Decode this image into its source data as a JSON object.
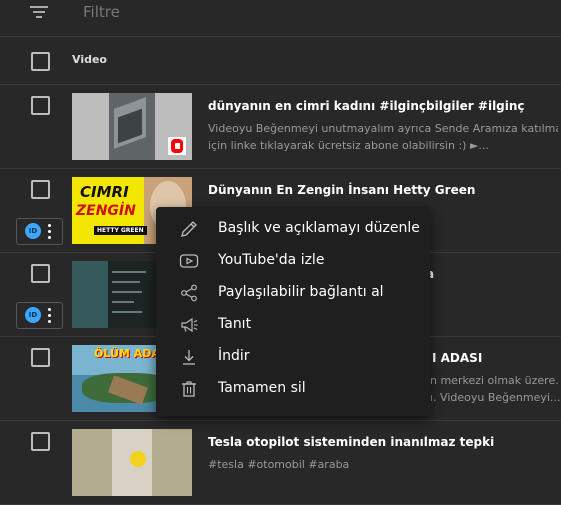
{
  "filter": {
    "placeholder": "Filtre"
  },
  "table": {
    "column_video": "Video"
  },
  "rows": [
    {
      "title": "dünyanın en cimri kadını #ilginçbilgiler #ilginç",
      "desc_line1": "Videoyu Beğenmeyi unutmayalım ayrıca Sende Aramıza katılmak",
      "desc_line2": "için linke tıklayarak ücretsiz abone olabilirsin :) ►..."
    },
    {
      "title": "Dünyanın En Zengin İnsanı Hetty Green",
      "thumb_text_1": "CIMRI",
      "thumb_text_2": "ZENGİN",
      "thumb_text_3": "HETTY GREEN"
    },
    {
      "title": "",
      "title_suffix": "a"
    },
    {
      "title_suffix": "I ADASI",
      "desc_line1_suffix": "n merkezi olmak üzere.",
      "desc_line2_suffix": "ı. Videoyu Beğenmeyi...",
      "thumb_text": "ÖLÜM ADA"
    },
    {
      "title": "Tesla otopilot sisteminden inanılmaz tepki",
      "desc_line1": "#tesla #otomobil #araba"
    }
  ],
  "studio_badge": "ID",
  "menu": {
    "items": [
      {
        "label": "Başlık ve açıklamayı düzenle",
        "icon": "pencil-icon"
      },
      {
        "label": "YouTube'da izle",
        "icon": "youtube-icon"
      },
      {
        "label": "Paylaşılabilir bağlantı al",
        "icon": "share-icon"
      },
      {
        "label": "Tanıt",
        "icon": "megaphone-icon"
      },
      {
        "label": "İndir",
        "icon": "download-icon"
      },
      {
        "label": "Tamamen sil",
        "icon": "trash-icon"
      }
    ]
  },
  "colors": {
    "background": "#282828",
    "menu_bg": "#1f1f1f",
    "accent": "#3ea6ff",
    "shorts_red": "#ff0000"
  }
}
